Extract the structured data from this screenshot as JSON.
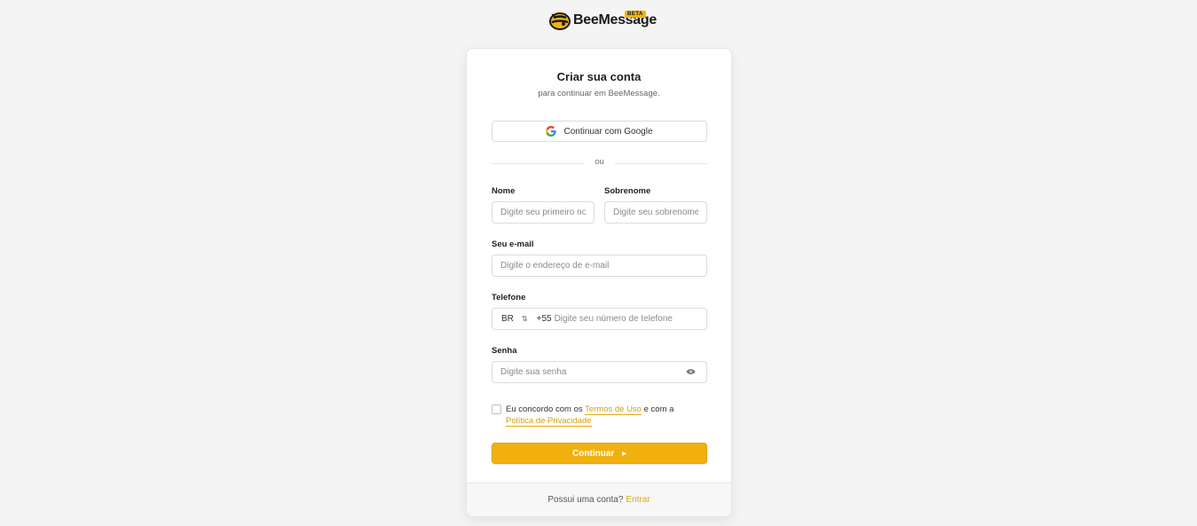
{
  "brand": {
    "name": "BeeMessage",
    "badge": "BETA",
    "accent": "#f0b10f"
  },
  "card": {
    "title": "Criar sua conta",
    "subtitle": "para continuar em BeeMessage.",
    "google_button": "Continuar com Google",
    "divider": "ou"
  },
  "form": {
    "first_name": {
      "label": "Nome",
      "placeholder": "Digite seu primeiro nome"
    },
    "last_name": {
      "label": "Sobrenome",
      "placeholder": "Digite seu sobrenome"
    },
    "email": {
      "label": "Seu e-mail",
      "placeholder": "Digite o endereço de e-mail"
    },
    "phone": {
      "label": "Telefone",
      "country": "BR",
      "dial_code": "+55",
      "placeholder": "Digite seu número de telefone"
    },
    "password": {
      "label": "Senha",
      "placeholder": "Digite sua senha"
    }
  },
  "terms": {
    "prefix": "Eu concordo com os ",
    "terms_link": "Termos de Uso",
    "middle": " e com a ",
    "privacy_link": "Política de Privacidade"
  },
  "continue_button": "Continuar",
  "footer": {
    "text": "Possui uma conta?",
    "link": "Entrar"
  }
}
